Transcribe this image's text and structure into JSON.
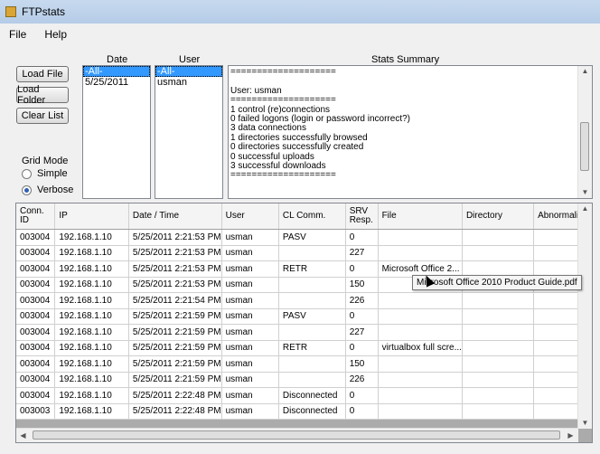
{
  "window": {
    "title": "FTPstats"
  },
  "menu": {
    "items": [
      "File",
      "Help"
    ]
  },
  "buttons": {
    "load_file": "Load File",
    "load_folder": "Load Folder",
    "clear_list": "Clear List"
  },
  "grid_mode": {
    "title": "Grid Mode",
    "options": [
      "Simple",
      "Verbose"
    ],
    "selected": "Verbose"
  },
  "date_pane": {
    "label": "Date",
    "items": [
      "-All-",
      "5/25/2011"
    ],
    "selected": "-All-"
  },
  "user_pane": {
    "label": "User",
    "items": [
      "-All-",
      "usman"
    ],
    "selected": "-All-"
  },
  "summary": {
    "label": "Stats Summary",
    "lines": [
      "====================",
      "",
      "User: usman",
      "====================",
      "1 control (re)connections",
      "0 failed logons (login or password incorrect?)",
      "3 data connections",
      "1 directories successfully browsed",
      "0 directories successfully created",
      "0 successful uploads",
      "3 successful downloads",
      "===================="
    ]
  },
  "grid": {
    "columns": [
      "Conn. ID",
      "IP",
      "Date / Time",
      "User",
      "CL Comm.",
      "SRV Resp.",
      "File",
      "Directory",
      "Abnormality"
    ],
    "rows": [
      [
        "003004",
        "192.168.1.10",
        "5/25/2011 2:21:53 PM",
        "usman",
        "PASV",
        "0",
        "",
        "",
        ""
      ],
      [
        "003004",
        "192.168.1.10",
        "5/25/2011 2:21:53 PM",
        "usman",
        "",
        "227",
        "",
        "",
        ""
      ],
      [
        "003004",
        "192.168.1.10",
        "5/25/2011 2:21:53 PM",
        "usman",
        "RETR",
        "0",
        "Microsoft Office 2...",
        "",
        ""
      ],
      [
        "003004",
        "192.168.1.10",
        "5/25/2011 2:21:53 PM",
        "usman",
        "",
        "150",
        "",
        "",
        ""
      ],
      [
        "003004",
        "192.168.1.10",
        "5/25/2011 2:21:54 PM",
        "usman",
        "",
        "226",
        "",
        "",
        ""
      ],
      [
        "003004",
        "192.168.1.10",
        "5/25/2011 2:21:59 PM",
        "usman",
        "PASV",
        "0",
        "",
        "",
        ""
      ],
      [
        "003004",
        "192.168.1.10",
        "5/25/2011 2:21:59 PM",
        "usman",
        "",
        "227",
        "",
        "",
        ""
      ],
      [
        "003004",
        "192.168.1.10",
        "5/25/2011 2:21:59 PM",
        "usman",
        "RETR",
        "0",
        "virtualbox full scre...",
        "",
        ""
      ],
      [
        "003004",
        "192.168.1.10",
        "5/25/2011 2:21:59 PM",
        "usman",
        "",
        "150",
        "",
        "",
        ""
      ],
      [
        "003004",
        "192.168.1.10",
        "5/25/2011 2:21:59 PM",
        "usman",
        "",
        "226",
        "",
        "",
        ""
      ],
      [
        "003004",
        "192.168.1.10",
        "5/25/2011 2:22:48 PM",
        "usman",
        "Disconnected",
        "0",
        "",
        "",
        ""
      ],
      [
        "003003",
        "192.168.1.10",
        "5/25/2011 2:22:48 PM",
        "usman",
        "Disconnected",
        "0",
        "",
        "",
        ""
      ]
    ]
  },
  "tooltip": {
    "text": "Microsoft Office 2010 Product Guide.pdf"
  }
}
